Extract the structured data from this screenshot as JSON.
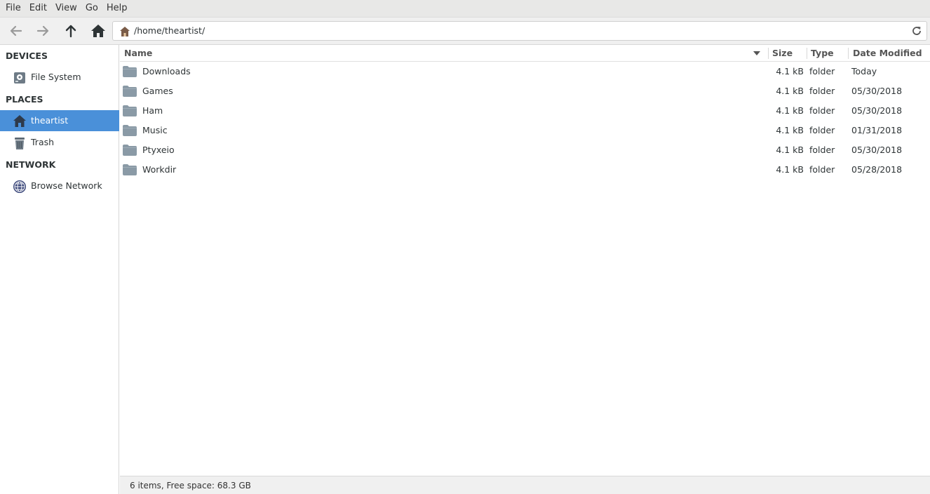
{
  "menubar": {
    "items": [
      "File",
      "Edit",
      "View",
      "Go",
      "Help"
    ]
  },
  "toolbar": {
    "back_icon": "arrow-left-icon",
    "forward_icon": "arrow-right-icon",
    "up_icon": "arrow-up-icon",
    "home_icon": "home-icon",
    "location": "/home/theartist/",
    "reload_icon": "reload-icon"
  },
  "sidebar": {
    "sections": [
      {
        "heading": "DEVICES",
        "items": [
          {
            "label": "File System",
            "icon": "drive-icon"
          }
        ]
      },
      {
        "heading": "PLACES",
        "items": [
          {
            "label": "theartist",
            "icon": "home-icon",
            "active": true
          },
          {
            "label": "Trash",
            "icon": "trash-icon"
          }
        ]
      },
      {
        "heading": "NETWORK",
        "items": [
          {
            "label": "Browse Network",
            "icon": "network-icon"
          }
        ]
      }
    ]
  },
  "table": {
    "columns": {
      "name": "Name",
      "size": "Size",
      "type": "Type",
      "date": "Date Modified"
    },
    "rows": [
      {
        "name": "Downloads",
        "size": "4.1 kB",
        "type": "folder",
        "date": "Today"
      },
      {
        "name": "Games",
        "size": "4.1 kB",
        "type": "folder",
        "date": "05/30/2018"
      },
      {
        "name": "Ham",
        "size": "4.1 kB",
        "type": "folder",
        "date": "05/30/2018"
      },
      {
        "name": "Music",
        "size": "4.1 kB",
        "type": "folder",
        "date": "01/31/2018"
      },
      {
        "name": "Ptyxeio",
        "size": "4.1 kB",
        "type": "folder",
        "date": "05/30/2018"
      },
      {
        "name": "Workdir",
        "size": "4.1 kB",
        "type": "folder",
        "date": "05/28/2018"
      }
    ]
  },
  "status": {
    "text": "6 items, Free space: 68.3 GB"
  },
  "colors": {
    "accent": "#4a90d9",
    "folder": "#8a9aa6",
    "home": "#2e3a4a"
  }
}
